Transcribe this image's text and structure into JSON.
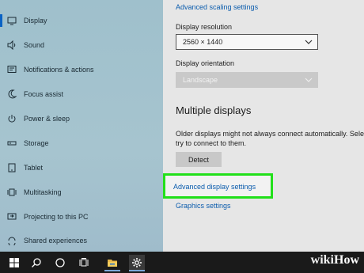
{
  "sidebar": {
    "items": [
      {
        "label": "Display",
        "icon": "display-icon",
        "active": true
      },
      {
        "label": "Sound",
        "icon": "speaker-icon"
      },
      {
        "label": "Notifications & actions",
        "icon": "notification-icon"
      },
      {
        "label": "Focus assist",
        "icon": "moon-icon"
      },
      {
        "label": "Power & sleep",
        "icon": "power-icon"
      },
      {
        "label": "Storage",
        "icon": "storage-icon"
      },
      {
        "label": "Tablet",
        "icon": "tablet-icon"
      },
      {
        "label": "Multitasking",
        "icon": "multitasking-icon"
      },
      {
        "label": "Projecting to this PC",
        "icon": "projector-icon"
      },
      {
        "label": "Shared experiences",
        "icon": "share-icon"
      }
    ]
  },
  "main": {
    "advanced_scaling_link": "Advanced scaling settings",
    "resolution_label": "Display resolution",
    "resolution_value": "2560 × 1440",
    "orientation_label": "Display orientation",
    "orientation_value": "Landscape",
    "multiple_displays_heading": "Multiple displays",
    "older_displays_text_1": "Older displays might not always connect automatically. Selec",
    "older_displays_text_2": "try to connect to them.",
    "detect_button": "Detect",
    "advanced_display_link": "Advanced display settings",
    "graphics_settings_link": "Graphics settings"
  },
  "taskbar": {
    "icons": [
      "windows-start-icon",
      "search-icon",
      "cortana-icon",
      "task-view-icon",
      "file-explorer-icon",
      "settings-gear-icon"
    ]
  },
  "watermark": {
    "prefix": "wiki",
    "suffix": "How"
  },
  "colors": {
    "accent": "#0a62c4",
    "link": "#0b5cad",
    "highlight_box": "#22e01a",
    "taskbar": "#1a1a1a"
  }
}
